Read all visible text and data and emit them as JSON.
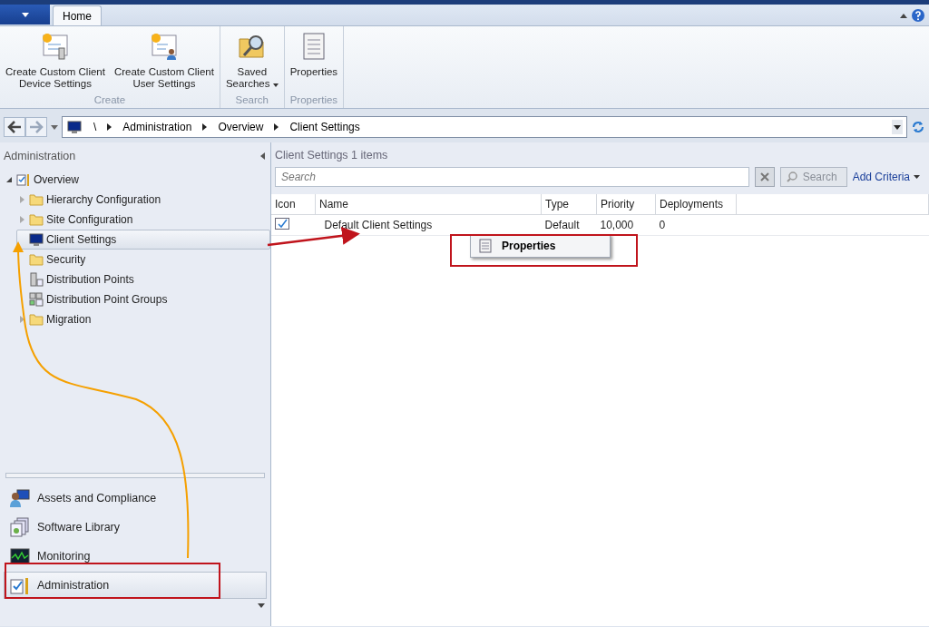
{
  "ribbon": {
    "tabs": [
      {
        "label": "Home",
        "selected": true
      }
    ],
    "groups": [
      {
        "label": "Create",
        "buttons": [
          {
            "label": "Create Custom Client\nDevice Settings",
            "kind": "device",
            "dropdown": false
          },
          {
            "label": "Create Custom Client\nUser Settings",
            "kind": "user",
            "dropdown": false
          }
        ]
      },
      {
        "label": "Search",
        "buttons": [
          {
            "label": "Saved\nSearches",
            "kind": "search",
            "dropdown": true
          }
        ]
      },
      {
        "label": "Properties",
        "buttons": [
          {
            "label": "Properties",
            "kind": "properties",
            "dropdown": false
          }
        ]
      }
    ]
  },
  "address_bar": {
    "path": [
      "\\",
      "Administration",
      "Overview",
      "Client Settings"
    ]
  },
  "navigation": {
    "title": "Administration",
    "tree": [
      {
        "label": "Overview",
        "kind": "overview",
        "expanded": true,
        "selected": false,
        "children": [
          {
            "label": "Hierarchy Configuration",
            "kind": "folder",
            "expandable": true,
            "selected": false
          },
          {
            "label": "Site Configuration",
            "kind": "folder",
            "expandable": true,
            "selected": false
          },
          {
            "label": "Client Settings",
            "kind": "monitor",
            "expandable": false,
            "selected": true
          },
          {
            "label": "Security",
            "kind": "folder",
            "expandable": false,
            "selected": false
          },
          {
            "label": "Distribution Points",
            "kind": "server",
            "expandable": false,
            "selected": false
          },
          {
            "label": "Distribution Point Groups",
            "kind": "servers",
            "expandable": false,
            "selected": false
          },
          {
            "label": "Migration",
            "kind": "folder",
            "expandable": true,
            "selected": false
          }
        ]
      }
    ],
    "workspaces": [
      {
        "label": "Assets and Compliance",
        "kind": "assets",
        "selected": false
      },
      {
        "label": "Software Library",
        "kind": "library",
        "selected": false
      },
      {
        "label": "Monitoring",
        "kind": "monitoring",
        "selected": false
      },
      {
        "label": "Administration",
        "kind": "admin",
        "selected": true
      }
    ]
  },
  "content": {
    "title": "Client Settings 1 items",
    "search": {
      "placeholder": "Search",
      "button": "Search"
    },
    "add_criteria": "Add Criteria",
    "table": {
      "columns": [
        "Icon",
        "Name",
        "Type",
        "Priority",
        "Deployments"
      ],
      "rows": [
        {
          "name": "Default Client Settings",
          "type": "Default",
          "priority": "10,000",
          "deployments": "0"
        }
      ]
    },
    "context_menu": {
      "items": [
        "Properties"
      ]
    }
  }
}
